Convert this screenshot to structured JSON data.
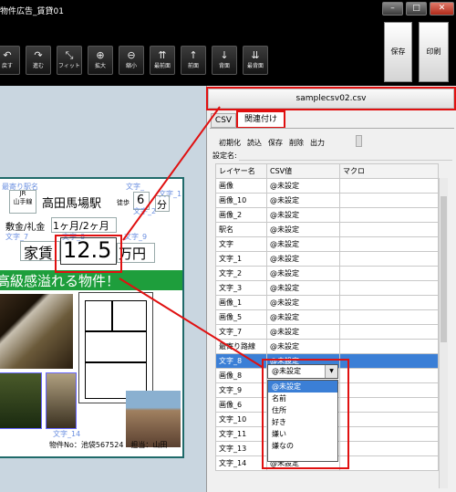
{
  "window": {
    "title": "物件広告_賃貸01",
    "min_symbol": "–",
    "max_symbol": "□",
    "close_symbol": "✕"
  },
  "toolbar": {
    "buttons": [
      {
        "label": "戻す",
        "icon": "↶"
      },
      {
        "label": "進む",
        "icon": "↷"
      },
      {
        "label": "フィット",
        "icon": "⤡"
      },
      {
        "label": "拡大",
        "icon": "⊕"
      },
      {
        "label": "縮小",
        "icon": "⊖"
      },
      {
        "label": "最前面",
        "icon": "⇈"
      },
      {
        "label": "前面",
        "icon": "↑"
      },
      {
        "label": "背面",
        "icon": "↓"
      },
      {
        "label": "最背面",
        "icon": "⇊"
      }
    ],
    "save_label": "保存",
    "print_label": "印刷"
  },
  "canvas": {
    "ghost_texts": [
      "最寄り駅名",
      "文字_",
      "文字_1",
      "文字_2",
      "文字_7",
      "文字_8",
      "文字_9",
      "文字_14"
    ],
    "line_label": "JR\n山手線",
    "station": "高田馬場駅",
    "walk_label": "徒歩",
    "walk_minutes": "6",
    "minute_unit": "分",
    "deposit_label": "敷金/礼金",
    "deposit_value": "1ヶ月/2ヶ月",
    "rent_label": "家賃",
    "rent_value": "12.5",
    "rent_unit": "万円",
    "banner": "高級感溢れる物件！",
    "footer_text": "物件No：池袋567524　担当：山田"
  },
  "panel": {
    "filename": "samplecsv02.csv",
    "tabs": [
      "CSV",
      "関連付け"
    ],
    "active_tab_index": 1,
    "menu": [
      "初期化",
      "読込",
      "保存",
      "削除",
      "出力"
    ],
    "setting_name_label": "設定名:",
    "columns": [
      "レイヤー名",
      "CSV値",
      "マクロ"
    ],
    "rows": [
      {
        "layer": "画像",
        "csv": "@未設定"
      },
      {
        "layer": "画像_10",
        "csv": "@未設定"
      },
      {
        "layer": "画像_2",
        "csv": "@未設定"
      },
      {
        "layer": "駅名",
        "csv": "@未設定"
      },
      {
        "layer": "文字",
        "csv": "@未設定"
      },
      {
        "layer": "文字_1",
        "csv": "@未設定"
      },
      {
        "layer": "文字_2",
        "csv": "@未設定"
      },
      {
        "layer": "文字_3",
        "csv": "@未設定"
      },
      {
        "layer": "画像_1",
        "csv": "@未設定"
      },
      {
        "layer": "画像_5",
        "csv": "@未設定"
      },
      {
        "layer": "文字_7",
        "csv": "@未設定"
      },
      {
        "layer": "最寄り路線",
        "csv": "@未設定"
      },
      {
        "layer": "文字_8",
        "csv": "@未設定"
      },
      {
        "layer": "画像_8",
        "csv": ""
      },
      {
        "layer": "文字_9",
        "csv": ""
      },
      {
        "layer": "画像_6",
        "csv": ""
      },
      {
        "layer": "文字_10",
        "csv": ""
      },
      {
        "layer": "文字_11",
        "csv": ""
      },
      {
        "layer": "文字_13",
        "csv": "@未設定"
      },
      {
        "layer": "文字_14",
        "csv": "@未設定"
      }
    ],
    "selected_row_index": 12,
    "combo_value": "@未設定",
    "dropdown_options": [
      "@未設定",
      "名前",
      "住所",
      "好き",
      "嫌い",
      "嫌なの"
    ],
    "dropdown_highlight_index": 0
  },
  "colors": {
    "accent": "#3b7fd6",
    "highlight_red": "#e01010",
    "banner_green": "#1e9e3c",
    "frame_teal": "#1f6a6a"
  }
}
